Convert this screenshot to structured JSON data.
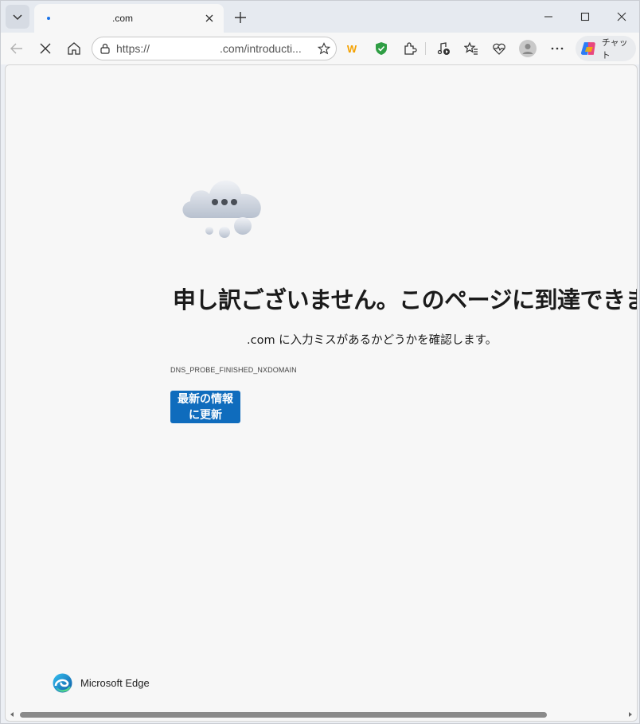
{
  "browser": {
    "tab": {
      "title_prefix": ".",
      "title_suffix": ".com"
    },
    "address": {
      "prefix": "https://",
      "suffix": ".com/introducti..."
    },
    "copilot_label": "チャット",
    "extension_badge": "W",
    "colors": {
      "accent": "#0f6cbd",
      "tab_dot": "#1a73e8",
      "shield": "#2f9e44",
      "badge": "#f4a100"
    }
  },
  "error_page": {
    "title": "申し訳ございません。このページに到達できません",
    "message_suffix": ".com に入力ミスがあるかどうかを確認します。",
    "error_code": "DNS_PROBE_FINISHED_NXDOMAIN",
    "refresh_label": "最新の情報に更新",
    "brand": "Microsoft Edge"
  }
}
